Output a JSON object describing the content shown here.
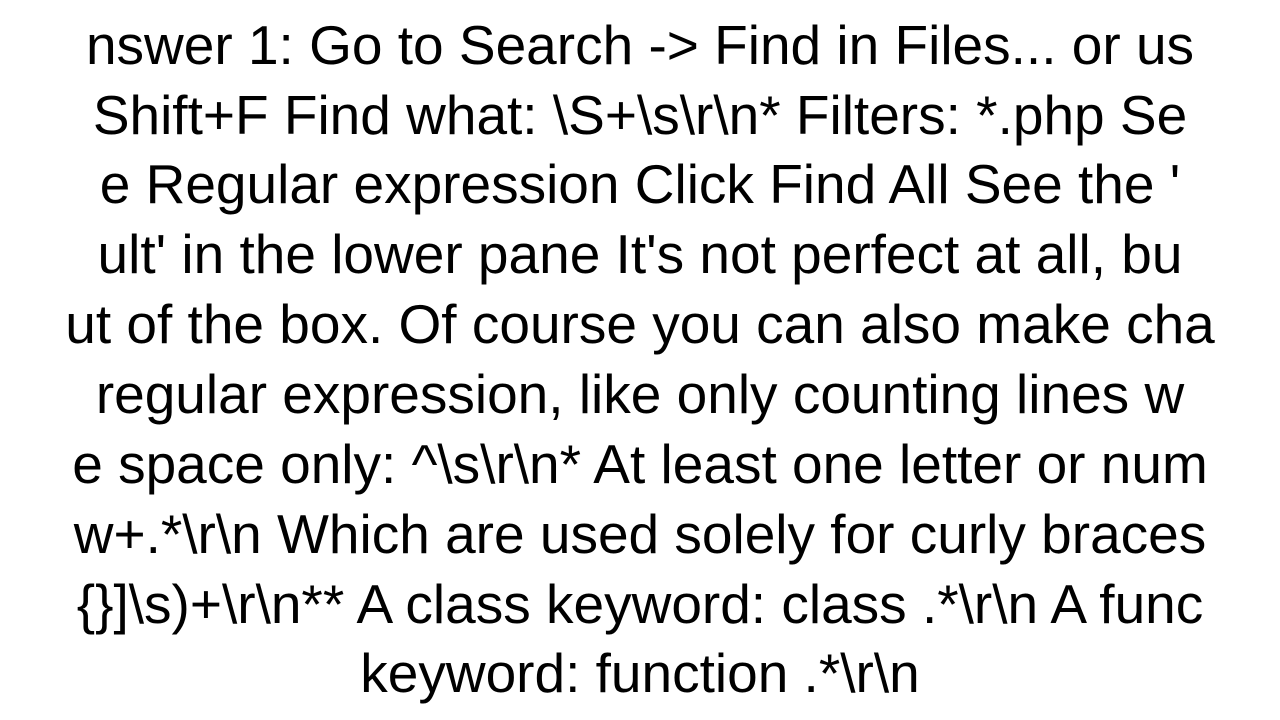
{
  "lines": [
    "nswer 1:  Go to Search -> Find in Files... or us",
    "Shift+F   Find what: \\S+\\s\\r\\n* Filters: *.php Se",
    "e Regular expression Click Find All   See the '",
    "ult' in the lower pane    It's not perfect at all, bu",
    "ut of the box. Of course you can also make cha",
    " regular expression, like only counting lines w",
    "e space only: ^\\s\\r\\n* At least one letter or num",
    "w+.*\\r\\n Which are used solely for curly braces",
    "{}]\\s)+\\r\\n** A class keyword: class .*\\r\\n A func",
    "keyword: function .*\\r\\n"
  ]
}
